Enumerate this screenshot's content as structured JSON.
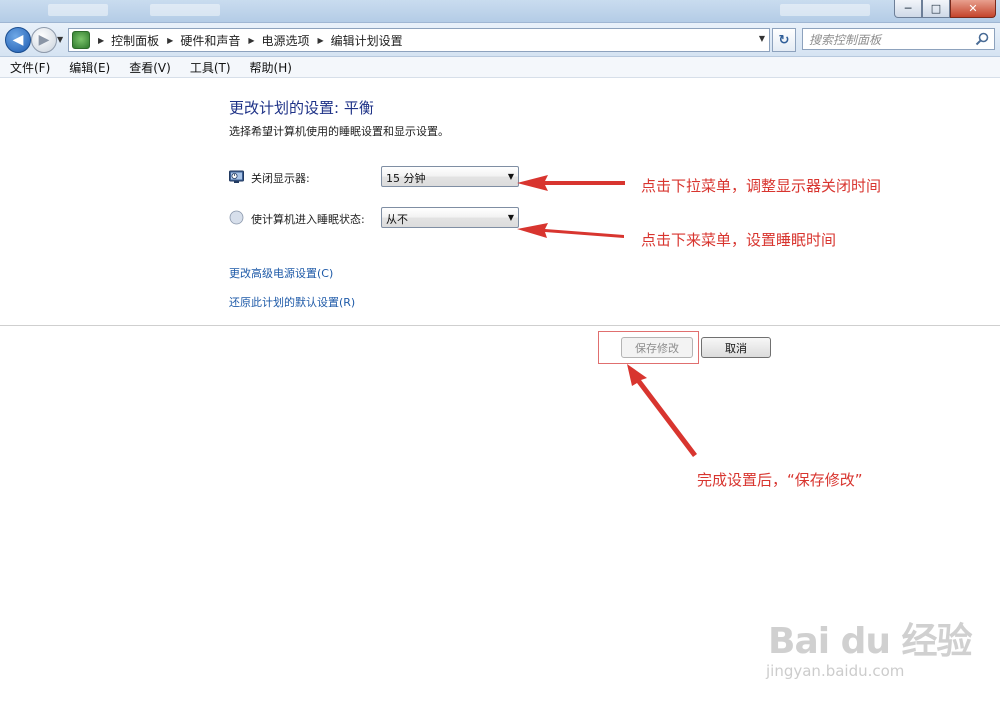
{
  "window": {
    "controls": {
      "minimize": "─",
      "maximize": "□",
      "close": "✕"
    }
  },
  "address_bar": {
    "breadcrumbs": [
      "控制面板",
      "硬件和声音",
      "电源选项",
      "编辑计划设置"
    ],
    "search_placeholder": "搜索控制面板"
  },
  "menu": [
    "文件(F)",
    "编辑(E)",
    "查看(V)",
    "工具(T)",
    "帮助(H)"
  ],
  "content": {
    "heading": "更改计划的设置: 平衡",
    "subtitle": "选择希望计算机使用的睡眠设置和显示设置。",
    "display_off": {
      "label": "关闭显示器:",
      "value": "15 分钟"
    },
    "sleep": {
      "label": "使计算机进入睡眠状态:",
      "value": "从不"
    },
    "links": {
      "advanced": "更改高级电源设置(C)",
      "restore": "还原此计划的默认设置(R)"
    },
    "buttons": {
      "save": "保存修改",
      "cancel": "取消"
    }
  },
  "annotations": {
    "display_tip": "点击下拉菜单，调整显示器关闭时间",
    "sleep_tip": "点击下来菜单，设置睡眠时间",
    "save_tip": "完成设置后，“保存修改”",
    "color": "#d8352f"
  },
  "watermark": {
    "brand": "Bai du 经验",
    "url": "jingyan.baidu.com"
  },
  "colors": {
    "heading": "#1e3287",
    "link": "#1e5aa8",
    "accent": "#1d5bb1"
  }
}
